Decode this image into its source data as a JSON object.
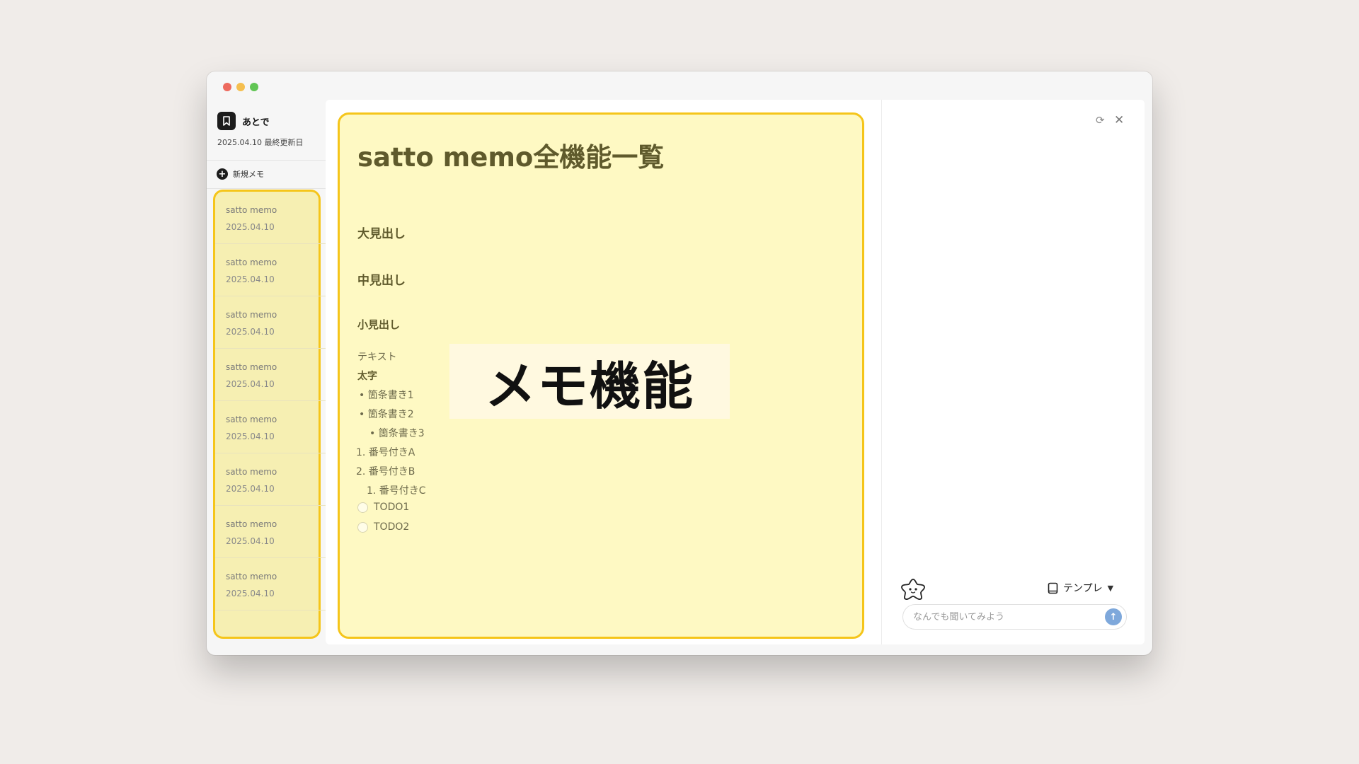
{
  "window": {
    "traffic_lights": [
      "close",
      "minimize",
      "zoom"
    ]
  },
  "sidebar": {
    "app_name": "あとで",
    "app_icon": "bookmark-icon",
    "updated_text": "2025.04.10 最終更新日",
    "new_memo_label": "新規メモ",
    "memos": [
      {
        "title": "satto memo",
        "date": "2025.04.10"
      },
      {
        "title": "satto memo",
        "date": "2025.04.10"
      },
      {
        "title": "satto memo",
        "date": "2025.04.10"
      },
      {
        "title": "satto memo",
        "date": "2025.04.10"
      },
      {
        "title": "satto memo",
        "date": "2025.04.10"
      },
      {
        "title": "satto memo",
        "date": "2025.04.10"
      },
      {
        "title": "satto memo",
        "date": "2025.04.10"
      },
      {
        "title": "satto memo",
        "date": "2025.04.10"
      }
    ],
    "settings_icon": "gear-icon"
  },
  "editor": {
    "title": "satto memo全機能一覧",
    "heading_large": "大見出し",
    "heading_medium": "中見出し",
    "heading_small": "小見出し",
    "text": "テキスト",
    "bold": "太字",
    "bullets": [
      "• 箇条書き1",
      "• 箇条書き2",
      "• 箇条書き3"
    ],
    "numbered": [
      "1. 番号付きA",
      "2. 番号付きB",
      "1. 番号付きC"
    ],
    "todos": [
      "TODO1",
      "TODO2"
    ]
  },
  "overlay": {
    "label": "メモ機能"
  },
  "chat": {
    "template_label": "テンプレ",
    "input_placeholder": "なんでも聞いてみよう",
    "icons": [
      "refresh-icon",
      "close-icon",
      "mascot-icon",
      "book-icon",
      "chevron-down-icon",
      "send-arrow-icon"
    ]
  },
  "colors": {
    "highlight_border": "#f5c51a",
    "editor_bg": "#fef9c3",
    "memo_list_bg": "#f6efb2",
    "send_button": "#7ea8db",
    "page_bg": "#f0ece9"
  }
}
